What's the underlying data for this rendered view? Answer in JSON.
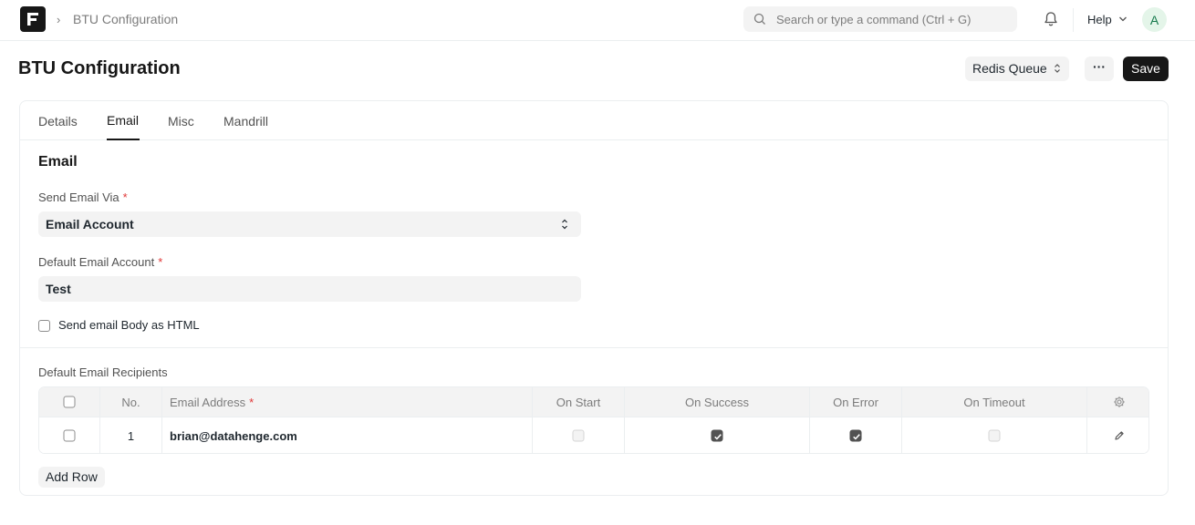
{
  "navbar": {
    "breadcrumb": "BTU Configuration",
    "search_placeholder": "Search or type a command (Ctrl + G)",
    "help_label": "Help",
    "avatar_initial": "A"
  },
  "page": {
    "title": "BTU Configuration",
    "queue_select": "Redis Queue",
    "more_label": "···",
    "save_label": "Save"
  },
  "tabs": [
    "Details",
    "Email",
    "Misc",
    "Mandrill"
  ],
  "active_tab": "Email",
  "section": {
    "title": "Email",
    "send_via_label": "Send Email Via",
    "send_via_value": "Email Account",
    "default_account_label": "Default Email Account",
    "default_account_value": "Test",
    "html_body_label": "Send email Body as HTML",
    "html_body_checked": false,
    "required_mark": "*"
  },
  "recipients": {
    "label": "Default Email Recipients",
    "columns": [
      "No.",
      "Email Address",
      "On Start",
      "On Success",
      "On Error",
      "On Timeout"
    ],
    "rows": [
      {
        "no": "1",
        "email": "brian@datahenge.com",
        "on_start": false,
        "on_success": true,
        "on_error": true,
        "on_timeout": false
      }
    ],
    "add_row_label": "Add Row"
  },
  "colors": {
    "primary": "#171717",
    "required": "#e03636",
    "field_bg": "#f3f3f3",
    "avatar_bg": "#e4f5e9",
    "avatar_fg": "#16794c"
  }
}
